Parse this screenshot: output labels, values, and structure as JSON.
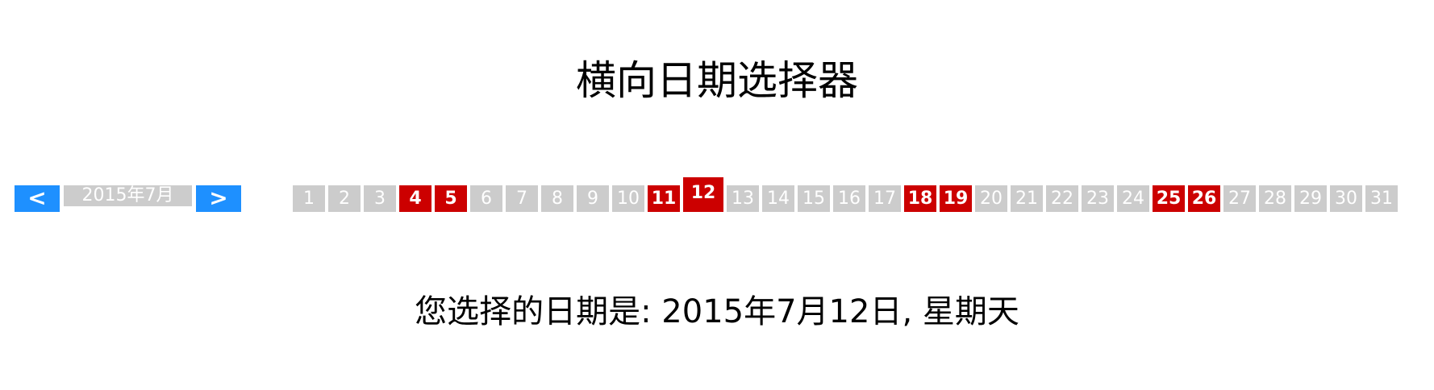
{
  "title": "横向日期选择器",
  "nav": {
    "prev_label": "<",
    "next_label": ">",
    "month_label": "2015年7月"
  },
  "days": [
    {
      "label": "1",
      "state": "normal"
    },
    {
      "label": "2",
      "state": "normal"
    },
    {
      "label": "3",
      "state": "normal"
    },
    {
      "label": "4",
      "state": "weekend"
    },
    {
      "label": "5",
      "state": "weekend"
    },
    {
      "label": "6",
      "state": "normal"
    },
    {
      "label": "7",
      "state": "normal"
    },
    {
      "label": "8",
      "state": "normal"
    },
    {
      "label": "9",
      "state": "normal"
    },
    {
      "label": "10",
      "state": "normal"
    },
    {
      "label": "11",
      "state": "weekend"
    },
    {
      "label": "12",
      "state": "selected"
    },
    {
      "label": "13",
      "state": "normal"
    },
    {
      "label": "14",
      "state": "normal"
    },
    {
      "label": "15",
      "state": "normal"
    },
    {
      "label": "16",
      "state": "normal"
    },
    {
      "label": "17",
      "state": "normal"
    },
    {
      "label": "18",
      "state": "weekend"
    },
    {
      "label": "19",
      "state": "weekend"
    },
    {
      "label": "20",
      "state": "normal"
    },
    {
      "label": "21",
      "state": "normal"
    },
    {
      "label": "22",
      "state": "normal"
    },
    {
      "label": "23",
      "state": "normal"
    },
    {
      "label": "24",
      "state": "normal"
    },
    {
      "label": "25",
      "state": "weekend"
    },
    {
      "label": "26",
      "state": "weekend"
    },
    {
      "label": "27",
      "state": "normal"
    },
    {
      "label": "28",
      "state": "normal"
    },
    {
      "label": "29",
      "state": "normal"
    },
    {
      "label": "30",
      "state": "normal"
    },
    {
      "label": "31",
      "state": "normal"
    }
  ],
  "result_text": "您选择的日期是: 2015年7月12日, 星期天",
  "colors": {
    "accent": "#1e90ff",
    "weekend": "#cc0000",
    "day_bg": "#cccccc"
  }
}
